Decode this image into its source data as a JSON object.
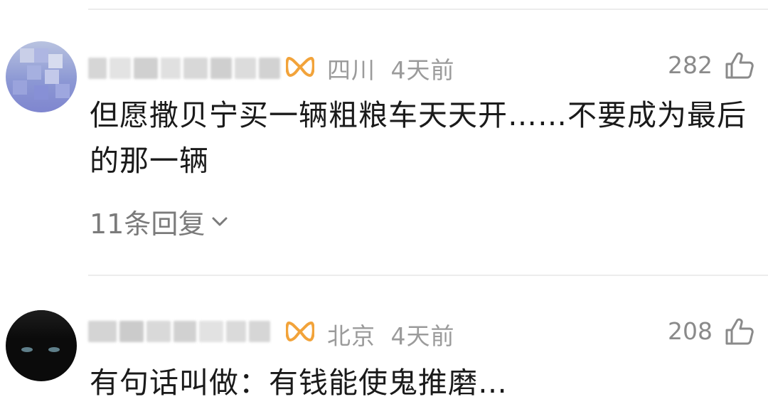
{
  "comments": [
    {
      "region": "四川",
      "time": "4天前",
      "likes": "282",
      "text": "但愿撒贝宁买一辆粗粮车天天开……不要成为最后的那一辆",
      "replies": "11条回复",
      "avatar": "blurred-avatar",
      "badge_icon": "vip-badge-icon"
    },
    {
      "region": "北京",
      "time": "4天前",
      "likes": "208",
      "text": "有句话叫做：有钱能使鬼推磨…",
      "avatar": "black-cat-avatar",
      "badge_icon": "vip-badge-icon"
    }
  ],
  "colors": {
    "badge": "#f2a33a",
    "meta": "#9b9b9b",
    "text": "#1a1a1a",
    "divider": "#ececec"
  }
}
